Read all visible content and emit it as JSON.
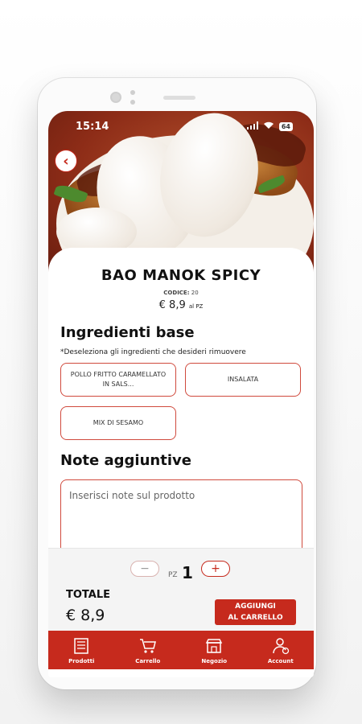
{
  "status_bar": {
    "time": "15:14",
    "battery": "64"
  },
  "product": {
    "name": "BAO MANOK SPICY",
    "code_label": "CODICE:",
    "code_value": "20",
    "price": "€ 8,9",
    "price_unit": "al PZ"
  },
  "ingredients": {
    "heading": "Ingredienti base",
    "hint": "*Deseleziona gli ingredienti che desideri rimuovere",
    "items": [
      "POLLO FRITTO CARAMELLATO IN SALS...",
      "INSALATA",
      "MIX DI SESAMO"
    ]
  },
  "notes": {
    "heading": "Note aggiuntive",
    "placeholder": "Inserisci note sul prodotto"
  },
  "quantity": {
    "minus": "−",
    "plus": "+",
    "unit": "PZ",
    "value": "1"
  },
  "total": {
    "label": "TOTALE",
    "value": "€ 8,9"
  },
  "add_button": {
    "line1": "AGGIUNGI",
    "line2": "AL CARRELLO"
  },
  "nav": [
    "Prodotti",
    "Carrello",
    "Negozio",
    "Account"
  ],
  "colors": {
    "accent": "#c62a1d"
  },
  "icons": [
    "back-arrow-icon",
    "wifi-icon",
    "signal-icon",
    "battery-icon",
    "menu-board-icon",
    "cart-icon",
    "store-icon",
    "account-icon"
  ]
}
